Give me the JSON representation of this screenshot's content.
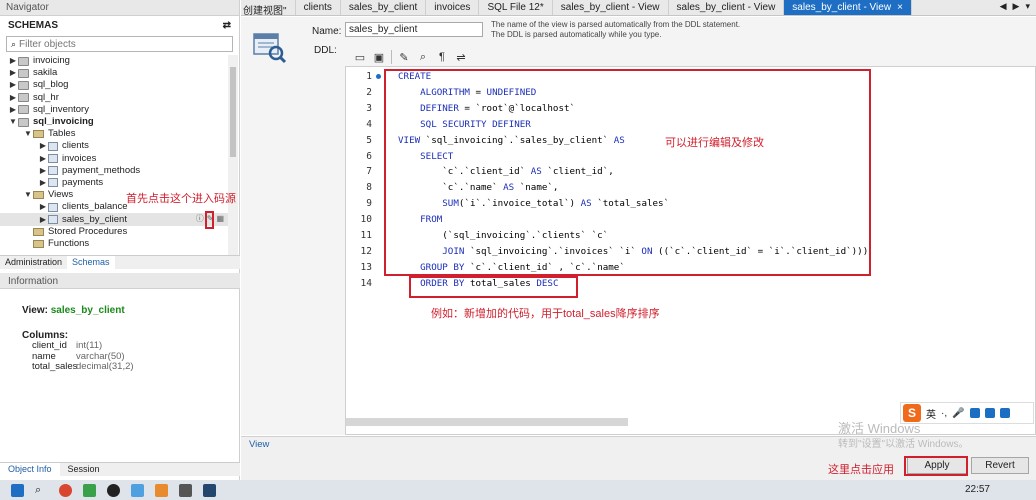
{
  "navigator": {
    "title": "Navigator",
    "schemas_label": "SCHEMAS",
    "filter_placeholder": "Filter objects",
    "tree": [
      {
        "label": "invoicing",
        "level": 0,
        "type": "db",
        "arrow": "▶"
      },
      {
        "label": "sakila",
        "level": 0,
        "type": "db",
        "arrow": "▶"
      },
      {
        "label": "sql_blog",
        "level": 0,
        "type": "db",
        "arrow": "▶"
      },
      {
        "label": "sql_hr",
        "level": 0,
        "type": "db",
        "arrow": "▶"
      },
      {
        "label": "sql_inventory",
        "level": 0,
        "type": "db",
        "arrow": "▶"
      },
      {
        "label": "sql_invoicing",
        "level": 0,
        "type": "db",
        "arrow": "▼",
        "bold": true
      },
      {
        "label": "Tables",
        "level": 1,
        "type": "folder",
        "arrow": "▼"
      },
      {
        "label": "clients",
        "level": 2,
        "type": "table",
        "arrow": "▶"
      },
      {
        "label": "invoices",
        "level": 2,
        "type": "table",
        "arrow": "▶"
      },
      {
        "label": "payment_methods",
        "level": 2,
        "type": "table",
        "arrow": "▶"
      },
      {
        "label": "payments",
        "level": 2,
        "type": "table",
        "arrow": "▶"
      },
      {
        "label": "Views",
        "level": 1,
        "type": "folder",
        "arrow": "▼"
      },
      {
        "label": "clients_balance",
        "level": 2,
        "type": "table",
        "arrow": "▶"
      },
      {
        "label": "sales_by_client",
        "level": 2,
        "type": "table",
        "arrow": "▶",
        "selected": true
      },
      {
        "label": "Stored Procedures",
        "level": 1,
        "type": "folder",
        "arrow": ""
      },
      {
        "label": "Functions",
        "level": 1,
        "type": "folder",
        "arrow": ""
      }
    ],
    "tabs": [
      "Administration",
      "Schemas"
    ],
    "info_title": "Information",
    "info": {
      "view_prefix": "View:",
      "view_name": "sales_by_client",
      "columns_title": "Columns:",
      "columns": [
        {
          "name": "client_id",
          "type": "int(11)"
        },
        {
          "name": "name",
          "type": "varchar(50)"
        },
        {
          "name": "total_sales",
          "type": "decimal(31,2)"
        }
      ]
    },
    "bottom_tabs": [
      "Object Info",
      "Session"
    ]
  },
  "tabbar": {
    "first_tab": "创建视图\"",
    "tabs": [
      "clients",
      "sales_by_client",
      "invoices",
      "SQL File 12*",
      "sales_by_client - View",
      "sales_by_client - View",
      "sales_by_client - View"
    ],
    "active_tab": "sales_by_client - View",
    "close_glyph": "×"
  },
  "editor": {
    "name_label": "Name:",
    "name_value": "sales_by_client",
    "name_desc": "The name of the view is parsed automatically from the DDL statement. The DDL is parsed automatically while you type.",
    "ddl_label": "DDL:",
    "lines": [
      {
        "n": "1",
        "text": "CREATE"
      },
      {
        "n": "2",
        "text": "    ALGORITHM = UNDEFINED"
      },
      {
        "n": "3",
        "text": "    DEFINER = `root`@`localhost`"
      },
      {
        "n": "4",
        "text": "    SQL SECURITY DEFINER"
      },
      {
        "n": "5",
        "text": "VIEW `sql_invoicing`.`sales_by_client` AS"
      },
      {
        "n": "6",
        "text": "    SELECT"
      },
      {
        "n": "7",
        "text": "        `c`.`client_id` AS `client_id`,"
      },
      {
        "n": "8",
        "text": "        `c`.`name` AS `name`,"
      },
      {
        "n": "9",
        "text": "        SUM(`i`.`invoice_total`) AS `total_sales`"
      },
      {
        "n": "10",
        "text": "    FROM"
      },
      {
        "n": "11",
        "text": "        (`sql_invoicing`.`clients` `c`"
      },
      {
        "n": "12",
        "text": "        JOIN `sql_invoicing`.`invoices` `i` ON ((`c`.`client_id` = `i`.`client_id`)))"
      },
      {
        "n": "13",
        "text": "    GROUP BY `c`.`client_id` , `c`.`name`"
      },
      {
        "n": "14",
        "text": "    ORDER BY total_sales DESC"
      }
    ],
    "view_tab": "View",
    "apply_label": "Apply",
    "revert_label": "Revert"
  },
  "annotations": {
    "click_here": "首先点击这个进入码源",
    "editable": "可以进行编辑及修改",
    "example": "例如：新增加的代码，用于total_sales降序排序",
    "apply_hint": "这里点击应用"
  },
  "overlay": {
    "ime_label": "英",
    "watermark_line1": "激活 Windows",
    "watermark_line2": "转到\"设置\"以激活 Windows。",
    "clock": "22:57"
  }
}
